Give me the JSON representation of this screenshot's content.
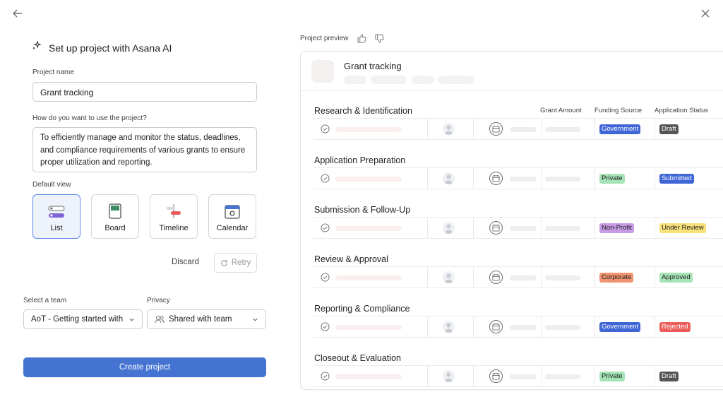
{
  "form": {
    "title": "Set up project with Asana AI",
    "project_name_label": "Project name",
    "project_name_value": "Grant tracking",
    "use_label": "How do you want to use the project?",
    "use_value": "To efficiently manage and monitor the status, deadlines, and compliance requirements of various grants to ensure proper utilization and reporting.",
    "default_view_label": "Default view",
    "views": [
      {
        "label": "List",
        "icon": "list-icon",
        "selected": true
      },
      {
        "label": "Board",
        "icon": "board-icon",
        "selected": false
      },
      {
        "label": "Timeline",
        "icon": "timeline-icon",
        "selected": false
      },
      {
        "label": "Calendar",
        "icon": "calendar-icon",
        "selected": false
      }
    ],
    "discard_label": "Discard",
    "retry_label": "Retry",
    "team_label": "Select a team",
    "team_value": "AoT - Getting started with",
    "privacy_label": "Privacy",
    "privacy_value": "Shared with team",
    "create_label": "Create project"
  },
  "preview": {
    "label": "Project preview",
    "project_title": "Grant tracking",
    "columns": [
      "Grant Amount",
      "Funding Source",
      "Application Status"
    ],
    "sections": [
      {
        "name": "Research & Identification",
        "funding": "Government",
        "status": "Draft"
      },
      {
        "name": "Application Preparation",
        "funding": "Private",
        "status": "Submitted"
      },
      {
        "name": "Submission & Follow-Up",
        "funding": "Non-Profit",
        "status": "Under Review"
      },
      {
        "name": "Review & Approval",
        "funding": "Corporate",
        "status": "Approved"
      },
      {
        "name": "Reporting & Compliance",
        "funding": "Government",
        "status": "Rejected"
      },
      {
        "name": "Closeout & Evaluation",
        "funding": "Private",
        "status": "Draft"
      }
    ]
  },
  "colors": {
    "accent": "#4573d2",
    "Government": "#3f66d6",
    "Private": "#a6e3b6",
    "Non-Profit": "#c99be6",
    "Corporate": "#f1946f",
    "Draft": "#545454",
    "Submitted": "#3f66d6",
    "Under Review": "#f8e07a",
    "Approved": "#a6e3b6",
    "Rejected": "#ec5d5a"
  }
}
